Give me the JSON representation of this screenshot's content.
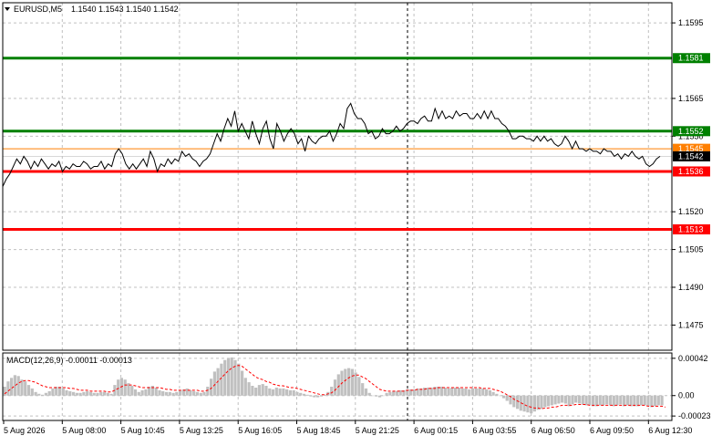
{
  "header": {
    "symbol": "EURUSD,M5",
    "ohlc": "1.1540 1.1543 1.1540 1.1542",
    "macd_label": "MACD(12,26,9) -0.00011 -0.00013"
  },
  "colors": {
    "support_green": "#008000",
    "resistance_red": "#ff0000",
    "orange": "#ff7f00",
    "current": "#000000",
    "grid": "#c0c0c0",
    "histogram": "#c0c0c0",
    "signal": "#ff0000"
  },
  "chart_data": [
    {
      "type": "line",
      "ylim": [
        1.1465,
        1.1603
      ],
      "y_ticks": [
        "1.1595",
        "1.1565",
        "1.1550",
        "1.1520",
        "1.1505",
        "1.1490",
        "1.1475"
      ],
      "y_tick_values": [
        1.1595,
        1.1565,
        1.155,
        1.152,
        1.1505,
        1.149,
        1.1475
      ],
      "x_labels": [
        "5 Aug 2026",
        "5 Aug 08:00",
        "5 Aug 10:45",
        "5 Aug 13:25",
        "5 Aug 16:05",
        "5 Aug 18:45",
        "5 Aug 21:25",
        "6 Aug 00:15",
        "6 Aug 03:55",
        "6 Aug 06:50",
        "6 Aug 09:50",
        "6 Aug 12:30"
      ],
      "levels": [
        {
          "label": "1.1581",
          "value": 1.1581,
          "color": "#008000"
        },
        {
          "label": "1.1552",
          "value": 1.1552,
          "color": "#008000"
        },
        {
          "label": "1.1545",
          "value": 1.1545,
          "color": "#ff7f00"
        },
        {
          "label": "1.1542",
          "value": 1.1542,
          "color": "#000000"
        },
        {
          "label": "1.1536",
          "value": 1.1536,
          "color": "#ff0000"
        },
        {
          "label": "1.1513",
          "value": 1.1513,
          "color": "#ff0000"
        }
      ],
      "series": [
        {
          "values": [
            1.153,
            1.1533,
            1.1535,
            1.1538,
            1.1541,
            1.1539,
            1.1542,
            1.154,
            1.1537,
            1.154,
            1.1538,
            1.1541,
            1.1539,
            1.1537,
            1.1539,
            1.1538,
            1.154,
            1.1536,
            1.1538,
            1.1537,
            1.1539,
            1.1538,
            1.1538,
            1.154,
            1.1539,
            1.1537,
            1.1538,
            1.1538,
            1.154,
            1.1537,
            1.1539,
            1.1538,
            1.1543,
            1.1545,
            1.1543,
            1.1539,
            1.1537,
            1.1539,
            1.1537,
            1.1539,
            1.1541,
            1.1538,
            1.1544,
            1.1541,
            1.1536,
            1.1539,
            1.1538,
            1.1541,
            1.1539,
            1.1541,
            1.154,
            1.1544,
            1.1542,
            1.1543,
            1.1541,
            1.154,
            1.1538,
            1.154,
            1.1541,
            1.1543,
            1.1547,
            1.1551,
            1.1548,
            1.1553,
            1.1557,
            1.1554,
            1.156,
            1.1552,
            1.1555,
            1.1552,
            1.1549,
            1.1556,
            1.1551,
            1.1547,
            1.1553,
            1.1556,
            1.1549,
            1.1545,
            1.1555,
            1.1552,
            1.1548,
            1.1551,
            1.1553,
            1.1551,
            1.1547,
            1.1549,
            1.1544,
            1.155,
            1.1548,
            1.1547,
            1.1549,
            1.155,
            1.155,
            1.1552,
            1.1548,
            1.1551,
            1.1555,
            1.1553,
            1.1561,
            1.1563,
            1.1559,
            1.1557,
            1.1557,
            1.1555,
            1.1551,
            1.1552,
            1.1549,
            1.155,
            1.1553,
            1.1551,
            1.1551,
            1.1552,
            1.1554,
            1.1552,
            1.1553,
            1.1555,
            1.1556,
            1.1556,
            1.1555,
            1.1557,
            1.1558,
            1.1556,
            1.1556,
            1.1561,
            1.1557,
            1.156,
            1.1557,
            1.1558,
            1.1557,
            1.156,
            1.1558,
            1.1559,
            1.1559,
            1.1557,
            1.1557,
            1.1559,
            1.1557,
            1.156,
            1.1557,
            1.156,
            1.1557,
            1.1557,
            1.1555,
            1.1554,
            1.1552,
            1.1549,
            1.1549,
            1.155,
            1.155,
            1.1549,
            1.1549,
            1.1548,
            1.155,
            1.1548,
            1.155,
            1.1548,
            1.1549,
            1.1547,
            1.1546,
            1.1547,
            1.155,
            1.1548,
            1.1545,
            1.1548,
            1.1545,
            1.1545,
            1.1544,
            1.1545,
            1.1544,
            1.1544,
            1.1543,
            1.1545,
            1.1544,
            1.1544,
            1.1542,
            1.1543,
            1.1541,
            1.1543,
            1.1542,
            1.1544,
            1.1542,
            1.1541,
            1.1542,
            1.1539,
            1.1538,
            1.1539,
            1.1541,
            1.1542
          ]
        }
      ]
    },
    {
      "type": "bar",
      "title": "MACD(12,26,9)",
      "ylim": [
        -0.00028,
        0.00048
      ],
      "y_ticks": [
        "0.00042",
        "0.00",
        "-0.00023"
      ],
      "y_tick_values": [
        0.00042,
        0.0,
        -0.00023
      ],
      "series": [
        {
          "name": "MACD",
          "values": [
            0.0001,
            0.00016,
            0.0002,
            0.00023,
            0.00022,
            0.00018,
            0.00016,
            0.00012,
            8e-05,
            4e-05,
            2e-05,
            1e-05,
            3e-05,
            5e-05,
            8e-05,
            0.0001,
            0.0001,
            8e-05,
            6e-05,
            5e-05,
            4e-05,
            3e-05,
            3e-05,
            4e-05,
            5e-05,
            4e-05,
            3e-05,
            3e-05,
            4e-05,
            4e-05,
            3e-05,
            2e-05,
            0.00012,
            0.00018,
            0.0002,
            0.00018,
            0.00014,
            0.00011,
            7e-05,
            4e-05,
            6e-05,
            7e-05,
            0.0001,
            0.00011,
            9e-05,
            6e-05,
            5e-05,
            4e-05,
            4e-05,
            3e-05,
            4e-05,
            6e-05,
            7e-05,
            8e-05,
            6e-05,
            5e-05,
            4e-05,
            3e-05,
            4e-05,
            0.0001,
            0.00019,
            0.00027,
            0.00031,
            0.00036,
            0.0004,
            0.00042,
            0.00043,
            0.0004,
            0.00036,
            0.00028,
            0.0002,
            0.00015,
            0.00011,
            9e-05,
            0.00012,
            0.00013,
            0.00011,
            8e-05,
            7e-05,
            9e-05,
            8e-05,
            8e-05,
            7e-05,
            6e-05,
            6e-05,
            4e-05,
            3e-05,
            2e-05,
            1e-05,
            -1e-05,
            -2e-05,
            -2e-05,
            -1e-05,
            1e-05,
            4e-05,
            0.0001,
            0.00018,
            0.00024,
            0.00028,
            0.0003,
            0.00031,
            0.0003,
            0.00026,
            0.00021,
            0.00014,
            8e-05,
            3e-05,
            0.0,
            -1e-05,
            -2e-05,
            0.0,
            3e-05,
            4e-05,
            5e-05,
            5e-05,
            6e-05,
            6e-05,
            7e-05,
            7e-05,
            7e-05,
            8e-05,
            8e-05,
            9e-05,
            9e-05,
            9e-05,
            0.0001,
            0.0001,
            0.0001,
            9e-05,
            8e-05,
            9e-05,
            9e-05,
            9e-05,
            8e-05,
            8e-05,
            7e-05,
            8e-05,
            8e-05,
            8e-05,
            8e-05,
            7e-05,
            6e-05,
            4e-05,
            2e-05,
            0.0,
            -3e-05,
            -6e-05,
            -0.0001,
            -0.00013,
            -0.00015,
            -0.00017,
            -0.00018,
            -0.00019,
            -0.0002,
            -0.00018,
            -0.00016,
            -0.00015,
            -0.00013,
            -0.00012,
            -0.00011,
            -0.0001,
            -9e-05,
            -8e-05,
            -9e-05,
            -0.00012,
            -0.0001,
            -8e-05,
            -9e-05,
            -0.0001,
            -0.00011,
            -0.00011,
            -0.00012,
            -0.00012,
            -0.00011,
            -0.00011,
            -0.0001,
            -0.00011,
            -0.00012,
            -0.00011,
            -0.0001,
            -0.00012,
            -0.00011,
            -0.00012,
            -0.00012,
            -0.00012,
            -0.00011,
            -0.00011,
            -0.00012,
            -0.00013,
            -0.00012,
            -0.00011,
            -0.00011
          ]
        },
        {
          "name": "Signal",
          "values": [
            2e-05,
            5e-05,
            8e-05,
            0.00011,
            0.00014,
            0.00016,
            0.00017,
            0.00017,
            0.00016,
            0.00015,
            0.00013,
            0.00011,
            0.0001,
            9e-05,
            9e-05,
            9e-05,
            9e-05,
            9e-05,
            9e-05,
            8e-05,
            8e-05,
            7e-05,
            6e-05,
            6e-05,
            6e-05,
            5e-05,
            5e-05,
            5e-05,
            5e-05,
            5e-05,
            4e-05,
            4e-05,
            6e-05,
            8e-05,
            0.0001,
            0.00012,
            0.00012,
            0.00012,
            0.00011,
            0.0001,
            9e-05,
            9e-05,
            9e-05,
            9e-05,
            9e-05,
            9e-05,
            8e-05,
            7e-05,
            7e-05,
            6e-05,
            6e-05,
            6e-05,
            6e-05,
            6e-05,
            6e-05,
            6e-05,
            6e-05,
            5e-05,
            5e-05,
            6e-05,
            8e-05,
            0.00012,
            0.00016,
            0.0002,
            0.00024,
            0.00028,
            0.00031,
            0.00033,
            0.00034,
            0.00033,
            0.0003,
            0.00027,
            0.00024,
            0.00021,
            0.00019,
            0.00018,
            0.00016,
            0.00015,
            0.00013,
            0.00012,
            0.00011,
            0.00011,
            0.0001,
            9e-05,
            9e-05,
            8e-05,
            7e-05,
            6e-05,
            5e-05,
            4e-05,
            3e-05,
            2e-05,
            1e-05,
            1e-05,
            2e-05,
            3e-05,
            6e-05,
            0.0001,
            0.00014,
            0.00017,
            0.0002,
            0.00022,
            0.00023,
            0.00023,
            0.00021,
            0.00019,
            0.00016,
            0.00013,
            0.0001,
            7e-05,
            6e-05,
            5e-05,
            5e-05,
            5e-05,
            5e-05,
            5e-05,
            5e-05,
            6e-05,
            6e-05,
            6e-05,
            7e-05,
            7e-05,
            7e-05,
            8e-05,
            8e-05,
            8e-05,
            9e-05,
            9e-05,
            9e-05,
            9e-05,
            9e-05,
            9e-05,
            9e-05,
            9e-05,
            9e-05,
            9e-05,
            9e-05,
            9e-05,
            9e-05,
            8e-05,
            8e-05,
            8e-05,
            7e-05,
            6e-05,
            5e-05,
            3e-05,
            1e-05,
            -1e-05,
            -4e-05,
            -6e-05,
            -8e-05,
            -0.0001,
            -0.00012,
            -0.00013,
            -0.00014,
            -0.00014,
            -0.00015,
            -0.00014,
            -0.00014,
            -0.00013,
            -0.00013,
            -0.00012,
            -0.00011,
            -0.00011,
            -0.00011,
            -0.00011,
            -0.0001,
            -0.0001,
            -0.0001,
            -0.0001,
            -0.00011,
            -0.00011,
            -0.00011,
            -0.00011,
            -0.00011,
            -0.00011,
            -0.00011,
            -0.00011,
            -0.00011,
            -0.00011,
            -0.00011,
            -0.00011,
            -0.00011,
            -0.00011,
            -0.00011,
            -0.00011,
            -0.00011,
            -0.00012,
            -0.00012,
            -0.00012,
            -0.00012,
            -0.00012,
            -0.00013
          ]
        }
      ]
    }
  ]
}
